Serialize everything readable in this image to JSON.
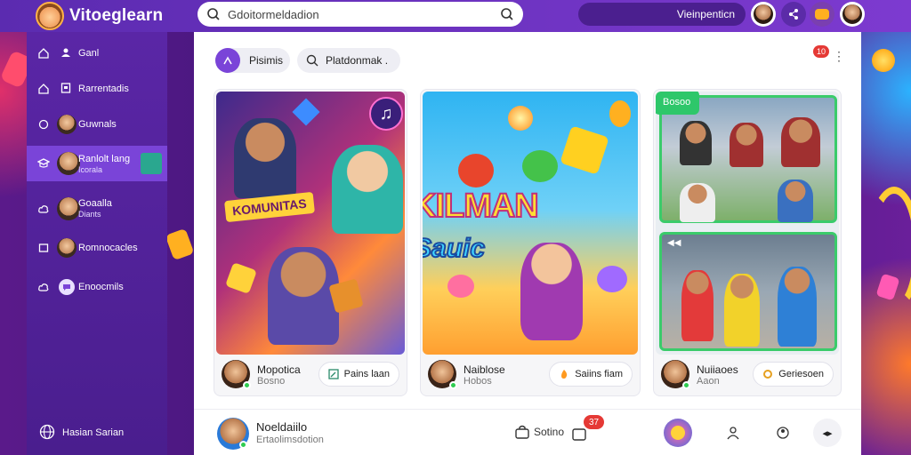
{
  "app": {
    "title": "Vitoeglearn"
  },
  "search": {
    "placeholder": "Gdoitormeldadion"
  },
  "top": {
    "pill_label": "Vieinpenticn"
  },
  "sidebar": {
    "items": [
      {
        "label": "Ganl",
        "icon": "home-icon"
      },
      {
        "label": "Rarrentadis",
        "icon": "bookmark-icon"
      },
      {
        "label": "Guwnals",
        "icon": "circle-icon"
      },
      {
        "label": "Ranlolt lang",
        "sub": "Icorala",
        "icon": "graduation-cap-icon",
        "active": true
      },
      {
        "label": "Goaalla",
        "sub": "Diants",
        "icon": "cloud-icon"
      },
      {
        "label": "Romnocacles",
        "icon": "square-icon"
      },
      {
        "label": "Enoocmils",
        "icon": "chat-icon"
      }
    ],
    "footer_label": "Hasian Sarian"
  },
  "chips": [
    {
      "label": "Pisimis",
      "icon": "play-icon"
    },
    {
      "label": "Platdonmak .",
      "icon": "search-icon"
    }
  ],
  "notification_count": "10",
  "cards": [
    {
      "art_text": "KOMUNITAS",
      "name": "Mopotica",
      "sub": "Bosno",
      "action": "Pains laan",
      "action_icon": "edit-icon"
    },
    {
      "art_text": "KILMAN",
      "art_text2": "Sauic",
      "name": "Naiblose",
      "sub": "Hobos",
      "action": "Saiins fiam",
      "action_icon": "flame-icon"
    },
    {
      "art_text": "Bosoo",
      "name": "Nuiiaoes",
      "sub": "Aaon",
      "action": "Geriesoen",
      "action_icon": "ring-icon"
    }
  ],
  "bottom": {
    "name": "Noeldaiilo",
    "sub": "Ertaolimsdotion",
    "center_label": "Sotino",
    "center_badge": "37"
  },
  "colors": {
    "accent": "#7d3ad0",
    "active_item": "#7a44d8",
    "green": "#2ecc50",
    "badge": "#e53935"
  }
}
